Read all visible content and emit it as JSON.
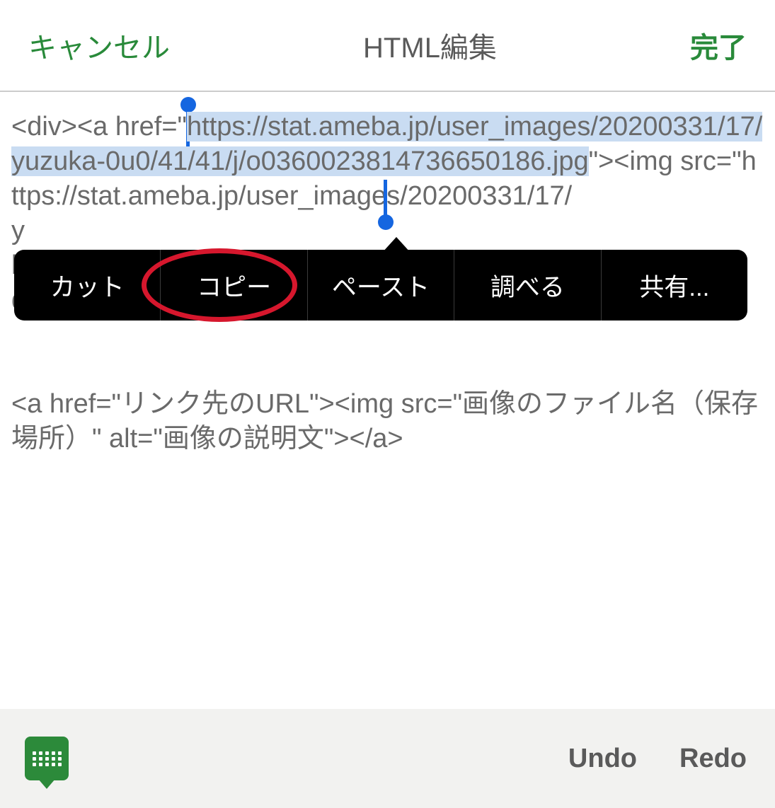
{
  "header": {
    "cancel_label": "キャンセル",
    "title": "HTML編集",
    "done_label": "完了"
  },
  "editor": {
    "pre_selection": "<div><a href=\"",
    "selected_text": "https://stat.ameba.jp/user_images/20200331/17/yuzuka-0u0/41/41/j/o0360023814736650186.jpg",
    "post_selection_line1": "\"><img src=\"https://stat.ameba.jp/user_images/20200331/17/",
    "hidden_line_prefix": "y",
    "hidden_line2_prefix": "b",
    "tail": "div><br>",
    "blank_gap": "",
    "paragraph2": "<a href=\"リンク先のURL\"><img src=\"画像のファイル名（保存場所）\" alt=\"画像の説明文\"></a>"
  },
  "context_menu": {
    "items": [
      "カット",
      "コピー",
      "ペースト",
      "調べる",
      "共有..."
    ]
  },
  "bottom_bar": {
    "undo_label": "Undo",
    "redo_label": "Redo"
  },
  "annotation": {
    "highlighted_item": "コピー"
  }
}
